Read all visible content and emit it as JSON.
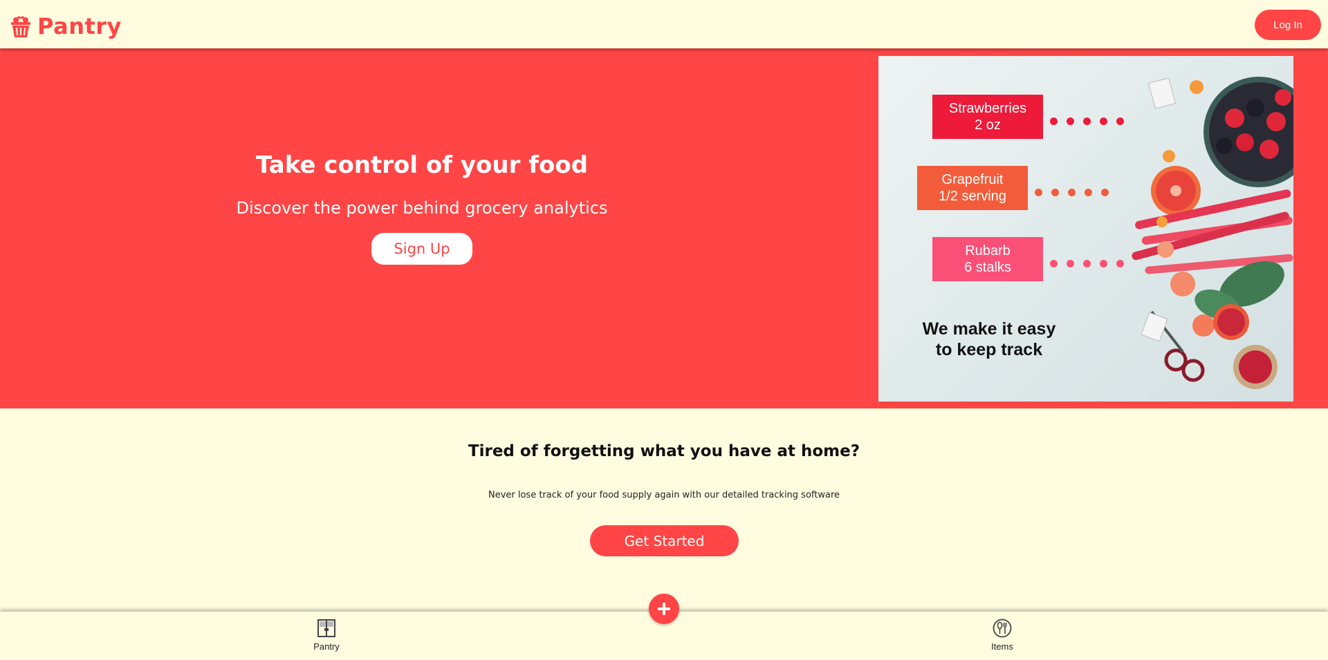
{
  "header": {
    "brand": "Pantry",
    "brand_icon": "basket-icon",
    "login_label": "Log In"
  },
  "hero": {
    "title": "Take control of your food",
    "subtitle": "Discover the power behind grocery analytics",
    "signup_label": "Sign Up",
    "image": {
      "tags": [
        {
          "name": "Strawberries",
          "amount": "2 oz",
          "color": "#ee1a3a"
        },
        {
          "name": "Grapefruit",
          "amount": "1/2 serving",
          "color": "#f25c3a"
        },
        {
          "name": "Rubarb",
          "amount": "6 stalks",
          "color": "#fa5078"
        }
      ],
      "tagline_line1": "We make it easy",
      "tagline_line2": "to keep track"
    }
  },
  "section": {
    "title": "Tired of forgetting what you have at home?",
    "subtitle": "Never lose track of your food supply again with our detailed tracking software",
    "cta_label": "Get Started"
  },
  "bottom_nav": {
    "items": [
      {
        "label": "Pantry",
        "icon": "pantry-cabinet-icon"
      },
      {
        "label": "Items",
        "icon": "utensils-icon"
      }
    ],
    "fab_icon": "plus-icon"
  },
  "colors": {
    "accent": "#ff4545",
    "background": "#fffcdf"
  }
}
